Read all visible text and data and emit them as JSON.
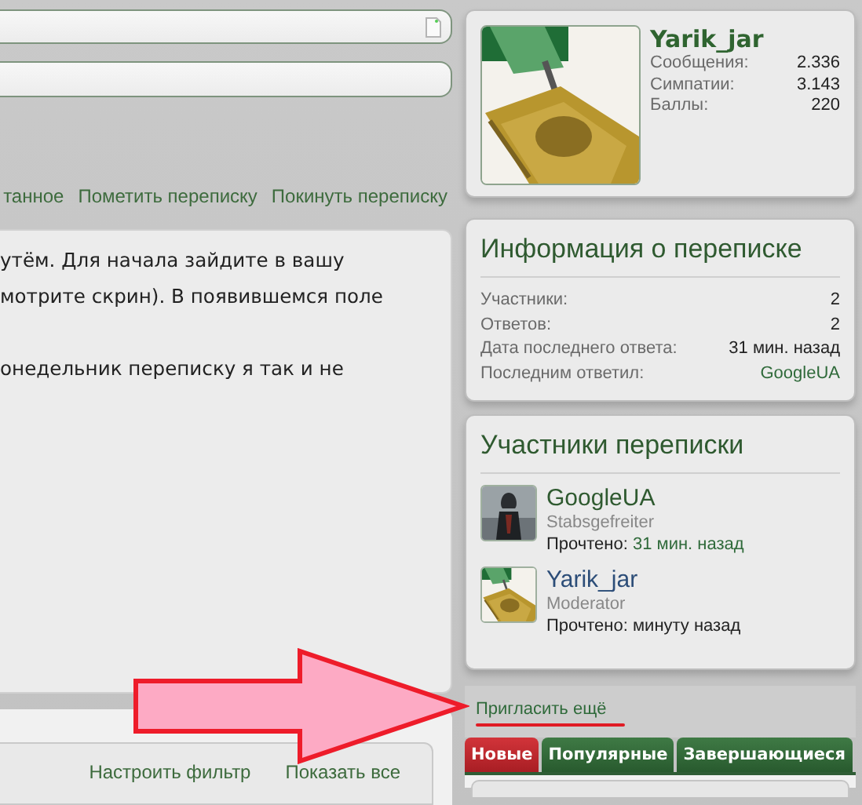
{
  "thread_actions": [
    {
      "label": "танное"
    },
    {
      "label": "Пометить переписку"
    },
    {
      "label": "Покинуть переписку"
    }
  ],
  "message": {
    "paragraphs": [
      [
        "утём. Для начала зайдите в вашу",
        "мотрите скрин). В появившемся поле"
      ],
      [
        "онедельник переписку я так и не"
      ]
    ]
  },
  "filter_bar": {
    "links": [
      "Настроить фильтр",
      "Показать все"
    ]
  },
  "profile": {
    "name": "Yarik_jar",
    "stats": [
      {
        "label": "Сообщения:",
        "value": "2.336"
      },
      {
        "label": "Симпатии:",
        "value": "3.143"
      },
      {
        "label": "Баллы:",
        "value": "220"
      }
    ]
  },
  "conversation_info": {
    "title": "Информация о переписке",
    "rows": [
      {
        "label": "Участники:",
        "value": "2",
        "kind": "text"
      },
      {
        "label": "Ответов:",
        "value": "2",
        "kind": "text"
      },
      {
        "label": "Дата последнего ответа:",
        "value": "31 мин. назад",
        "kind": "text"
      },
      {
        "label": "Последним ответил:",
        "value": "GoogleUA",
        "kind": "link"
      }
    ]
  },
  "participants": {
    "title": "Участники переписки",
    "members": [
      {
        "name": "GoogleUA",
        "rank": "Stabsgefreiter",
        "read_label": "Прочтено:",
        "read_time": "31 мин. назад",
        "kind": "link"
      },
      {
        "name": "Yarik_jar",
        "rank": "Moderator",
        "read_label": "Прочтено:",
        "read_time": "минуту назад",
        "kind": "text"
      }
    ]
  },
  "invite_link": "Пригласить ещё",
  "tabs": [
    {
      "label": "Новые",
      "selected": true
    },
    {
      "label": "Популярные",
      "selected": false
    },
    {
      "label": "Завершающиеся",
      "selected": false
    }
  ]
}
